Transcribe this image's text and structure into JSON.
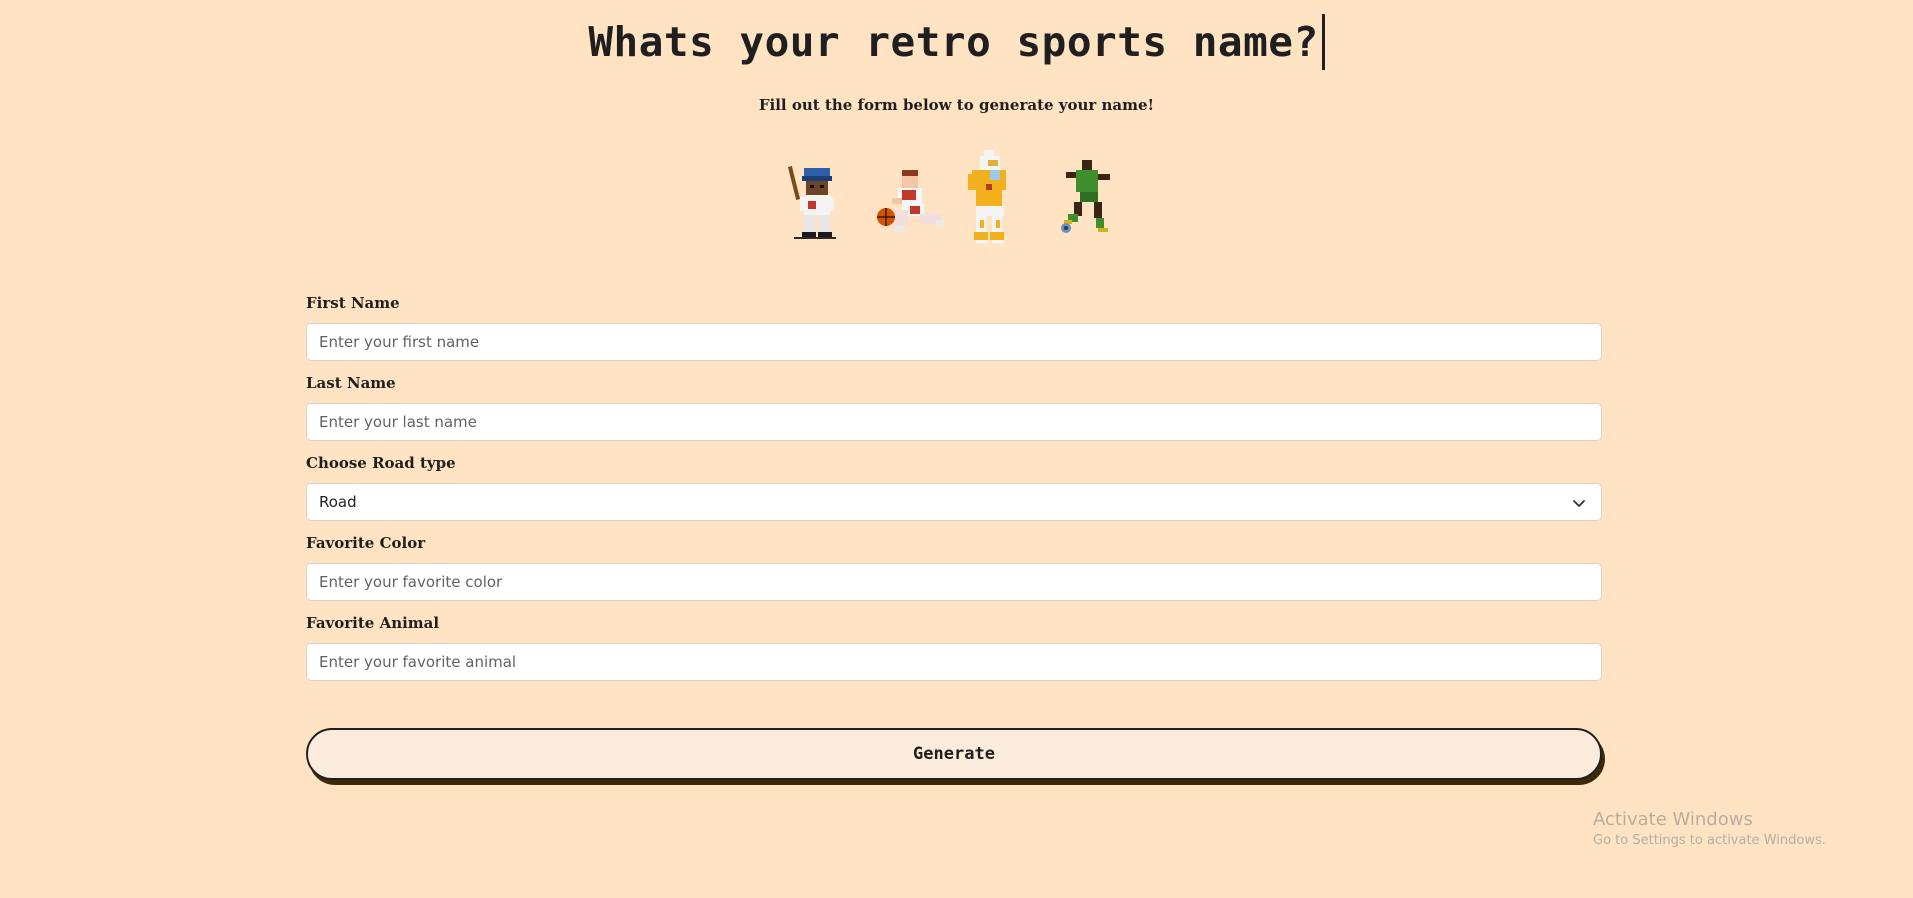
{
  "header": {
    "title": "Whats your retro sports name?",
    "subtitle": "Fill out the form below to generate your name!"
  },
  "sprites": [
    "baseball-player-icon",
    "basketball-player-icon",
    "football-player-icon",
    "soccer-player-icon"
  ],
  "form": {
    "first_name": {
      "label": "First Name",
      "placeholder": "Enter your first name",
      "value": ""
    },
    "last_name": {
      "label": "Last Name",
      "placeholder": "Enter your last name",
      "value": ""
    },
    "road_type": {
      "label": "Choose Road type",
      "selected": "Road"
    },
    "favorite_color": {
      "label": "Favorite Color",
      "placeholder": "Enter your favorite color",
      "value": ""
    },
    "favorite_animal": {
      "label": "Favorite Animal",
      "placeholder": "Enter your favorite animal",
      "value": ""
    },
    "generate_label": "Generate"
  },
  "watermark": {
    "title": "Activate Windows",
    "subtitle": "Go to Settings to activate Windows."
  },
  "colors": {
    "background": "#ffe3c2",
    "button_background": "#fcecdd",
    "button_shadow": "#3b2a0a",
    "text": "#1f1f1f"
  }
}
